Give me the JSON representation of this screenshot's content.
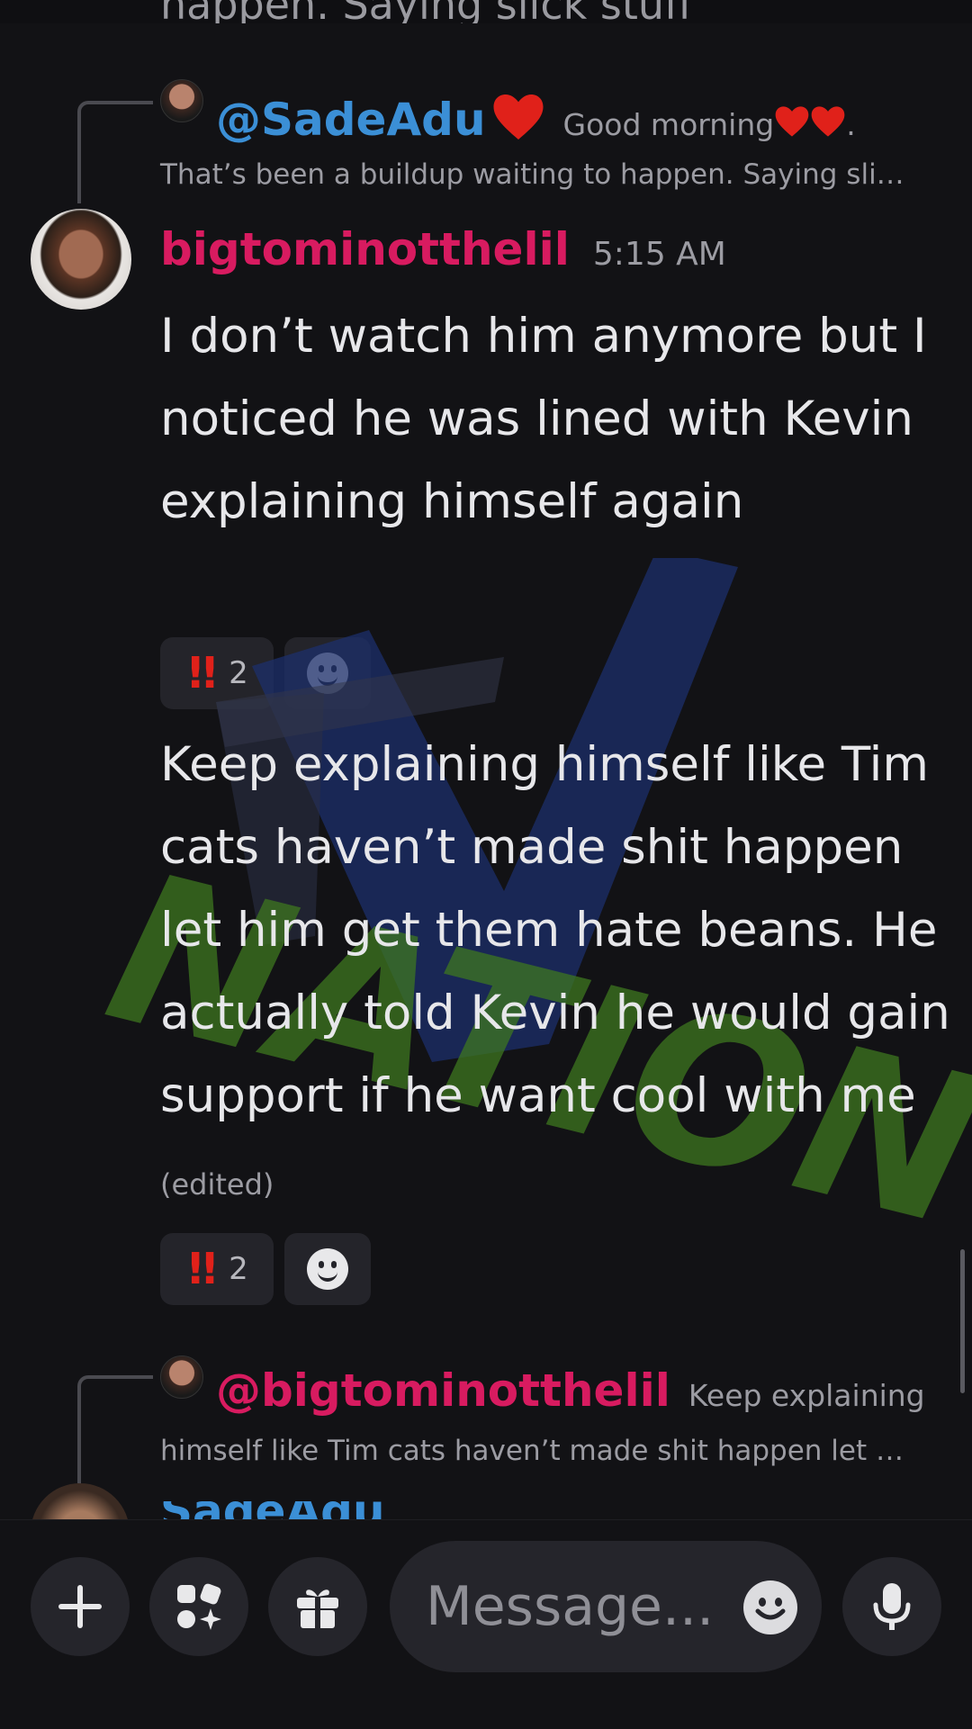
{
  "top_cutoff_text": "happen. Saying slick stuff",
  "reply1": {
    "mention": "@SadeAdu",
    "snippet_part": "Good morning",
    "line2": "That’s been a buildup waiting to happen. Saying sli…",
    "mention_color": "#3b8fd6"
  },
  "message": {
    "username": "bigtominotthelil",
    "timestamp": "5:15 AM",
    "text1": "I don’t watch him anymore but I noticed he was lined with Kevin explaining himself again",
    "reaction1": {
      "emoji": "!!",
      "count": "2"
    },
    "text2": "Keep explaining himself like Tim cats haven’t made shit happen let him get them hate beans. He actually told Kevin he would gain support if he want cool with me",
    "edited_label": "(edited)",
    "reaction2": {
      "emoji": "!!",
      "count": "2"
    },
    "username_color": "#d81b60"
  },
  "reply2": {
    "mention": "@bigtominotthelil",
    "snippet": "Keep explaining",
    "line2": "himself like Tim cats haven’t made shit happen let …",
    "mention_color": "#d81b60"
  },
  "next_author_partial": "SadeAdu",
  "composer": {
    "placeholder": "Message..."
  },
  "watermark": {
    "top": "TV",
    "bottom": "NATION"
  },
  "icons": [
    "plus-icon",
    "apps-icon",
    "gift-icon",
    "emoji-icon",
    "mic-icon",
    "heart-icon"
  ]
}
